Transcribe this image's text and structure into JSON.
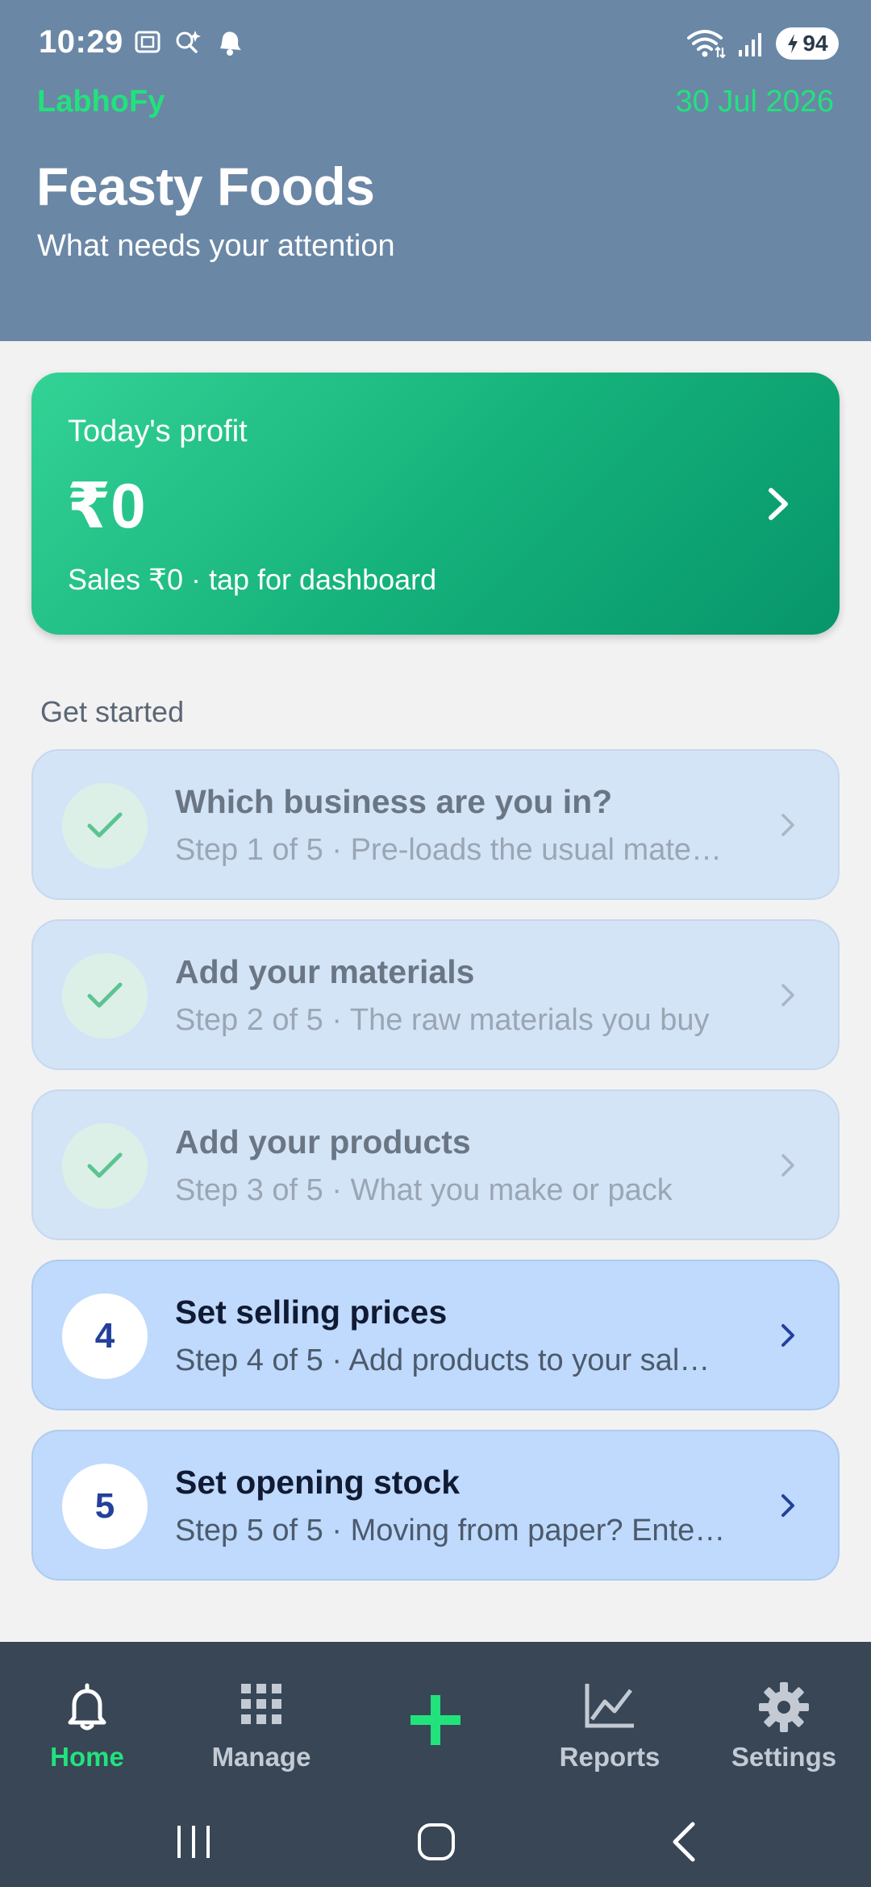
{
  "status_bar": {
    "time": "10:29",
    "battery": "94",
    "left_icons": [
      "screenshot-icon",
      "search-sparkle-icon",
      "notification-bell-icon"
    ],
    "right_icons": [
      "wifi-icon",
      "signal-icon",
      "battery-icon"
    ]
  },
  "header": {
    "brand": "LabhoFy",
    "date": "30 Jul 2026",
    "business_name": "Feasty Foods",
    "subtitle": "What needs your attention"
  },
  "profit_card": {
    "label": "Today's profit",
    "value": "₹0",
    "sub": "Sales ₹0 · tap for dashboard"
  },
  "get_started": {
    "label": "Get started",
    "steps": [
      {
        "state": "done",
        "badge": "",
        "title": "Which business are you in?",
        "sub": "Step 1 of 5 · Pre-loads the usual mate…"
      },
      {
        "state": "done",
        "badge": "",
        "title": "Add your materials",
        "sub": "Step 2 of 5 · The raw materials you buy"
      },
      {
        "state": "done",
        "badge": "",
        "title": "Add your products",
        "sub": "Step 3 of 5 · What you make or pack"
      },
      {
        "state": "todo",
        "badge": "4",
        "title": "Set selling prices",
        "sub": "Step 4 of 5 · Add products to your sal…"
      },
      {
        "state": "todo",
        "badge": "5",
        "title": "Set opening stock",
        "sub": "Step 5 of 5 · Moving from paper? Ente…"
      }
    ]
  },
  "bottom_nav": {
    "items": [
      {
        "label": "Home",
        "icon": "bell-icon",
        "active": true
      },
      {
        "label": "Manage",
        "icon": "grid-icon",
        "active": false
      },
      {
        "label": "",
        "icon": "plus-icon",
        "active": false
      },
      {
        "label": "Reports",
        "icon": "chart-icon",
        "active": false
      },
      {
        "label": "Settings",
        "icon": "gear-icon",
        "active": false
      }
    ]
  },
  "colors": {
    "header_bg": "#6a87a6",
    "accent_green": "#22e27c",
    "nav_bg": "#384656",
    "step_done_bg": "#d4e4f7",
    "step_todo_bg": "#bfdafc"
  }
}
